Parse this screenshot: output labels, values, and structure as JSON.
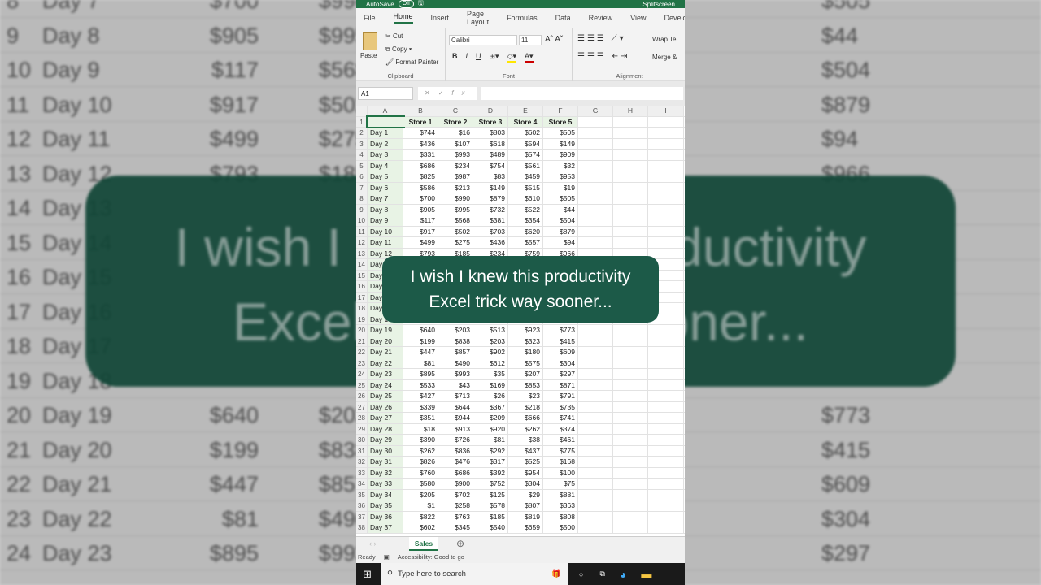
{
  "caption": {
    "line1": "I wish I knew this productivity",
    "line2": "Excel trick way sooner..."
  },
  "excel": {
    "title": {
      "autosave": "AutoSave",
      "toggle": "Off",
      "account": "Splitscreen"
    },
    "tabs": [
      "File",
      "Home",
      "Insert",
      "Page Layout",
      "Formulas",
      "Data",
      "Review",
      "View",
      "Develop"
    ],
    "clipboard": {
      "paste": "Paste",
      "cut": "Cut",
      "copy": "Copy",
      "format_painter": "Format Painter",
      "label": "Clipboard"
    },
    "font": {
      "name": "Calibri",
      "size": "11",
      "label": "Font",
      "bold": "B",
      "italic": "I",
      "underline": "U"
    },
    "alignment": {
      "wrap": "Wrap Te",
      "merge": "Merge &",
      "label": "Alignment"
    },
    "name_box": "A1",
    "columns": [
      "A",
      "B",
      "C",
      "D",
      "E",
      "F",
      "G",
      "H",
      "I"
    ],
    "headers": [
      "",
      "Store 1",
      "Store 2",
      "Store 3",
      "Store 4",
      "Store 5"
    ],
    "rows": [
      [
        "Day 1",
        "$744",
        "$16",
        "$803",
        "$602",
        "$505"
      ],
      [
        "Day 2",
        "$436",
        "$107",
        "$618",
        "$594",
        "$149"
      ],
      [
        "Day 3",
        "$331",
        "$993",
        "$489",
        "$574",
        "$909"
      ],
      [
        "Day 4",
        "$686",
        "$234",
        "$754",
        "$561",
        "$32"
      ],
      [
        "Day 5",
        "$825",
        "$987",
        "$83",
        "$459",
        "$953"
      ],
      [
        "Day 6",
        "$586",
        "$213",
        "$149",
        "$515",
        "$19"
      ],
      [
        "Day 7",
        "$700",
        "$990",
        "$879",
        "$610",
        "$505"
      ],
      [
        "Day 8",
        "$905",
        "$995",
        "$732",
        "$522",
        "$44"
      ],
      [
        "Day 9",
        "$117",
        "$568",
        "$381",
        "$354",
        "$504"
      ],
      [
        "Day 10",
        "$917",
        "$502",
        "$703",
        "$620",
        "$879"
      ],
      [
        "Day 11",
        "$499",
        "$275",
        "$436",
        "$557",
        "$94"
      ],
      [
        "Day 12",
        "$793",
        "$185",
        "$234",
        "$759",
        "$966"
      ],
      [
        "Day 13",
        "",
        "",
        "",
        "",
        ""
      ],
      [
        "Day 14",
        "",
        "",
        "",
        "",
        ""
      ],
      [
        "Day 15",
        "",
        "",
        "",
        "",
        ""
      ],
      [
        "Day 16",
        "",
        "",
        "",
        "",
        ""
      ],
      [
        "Day 17",
        "",
        "",
        "",
        "",
        ""
      ],
      [
        "Day 18",
        "",
        "",
        "",
        "",
        ""
      ],
      [
        "Day 19",
        "$640",
        "$203",
        "$513",
        "$923",
        "$773"
      ],
      [
        "Day 20",
        "$199",
        "$838",
        "$203",
        "$323",
        "$415"
      ],
      [
        "Day 21",
        "$447",
        "$857",
        "$902",
        "$180",
        "$609"
      ],
      [
        "Day 22",
        "$81",
        "$490",
        "$612",
        "$575",
        "$304"
      ],
      [
        "Day 23",
        "$895",
        "$993",
        "$35",
        "$207",
        "$297"
      ],
      [
        "Day 24",
        "$533",
        "$43",
        "$169",
        "$853",
        "$871"
      ],
      [
        "Day 25",
        "$427",
        "$713",
        "$26",
        "$23",
        "$791"
      ],
      [
        "Day 26",
        "$339",
        "$644",
        "$367",
        "$218",
        "$735"
      ],
      [
        "Day 27",
        "$351",
        "$944",
        "$209",
        "$666",
        "$741"
      ],
      [
        "Day 28",
        "$18",
        "$913",
        "$920",
        "$262",
        "$374"
      ],
      [
        "Day 29",
        "$390",
        "$726",
        "$81",
        "$38",
        "$461"
      ],
      [
        "Day 30",
        "$262",
        "$836",
        "$292",
        "$437",
        "$775"
      ],
      [
        "Day 31",
        "$826",
        "$476",
        "$317",
        "$525",
        "$168"
      ],
      [
        "Day 32",
        "$760",
        "$686",
        "$392",
        "$954",
        "$100"
      ],
      [
        "Day 33",
        "$580",
        "$900",
        "$752",
        "$304",
        "$75"
      ],
      [
        "Day 34",
        "$205",
        "$702",
        "$125",
        "$29",
        "$881"
      ],
      [
        "Day 35",
        "$1",
        "$258",
        "$578",
        "$807",
        "$363"
      ],
      [
        "Day 36",
        "$822",
        "$763",
        "$185",
        "$819",
        "$808"
      ],
      [
        "Day 37",
        "$602",
        "$345",
        "$540",
        "$659",
        "$500"
      ]
    ],
    "sheet_tab": "Sales",
    "status": {
      "ready": "Ready",
      "accessibility": "Accessibility: Good to go"
    }
  },
  "taskbar": {
    "search_placeholder": "Type here to search"
  }
}
